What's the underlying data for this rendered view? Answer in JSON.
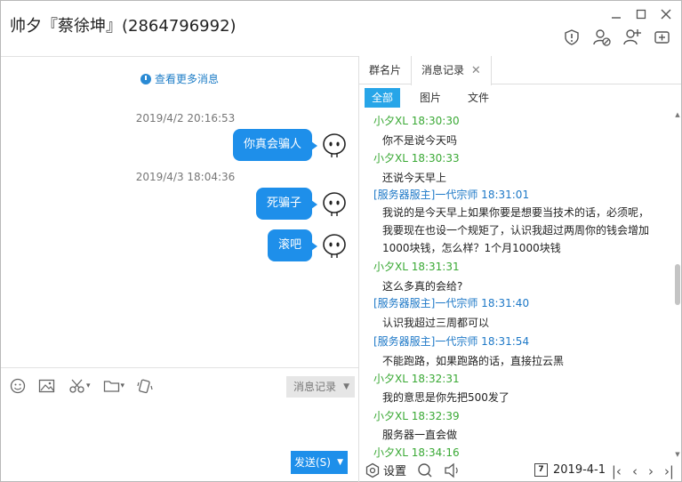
{
  "window": {
    "title": "帅夕『蔡徐坤』(2864796992)",
    "controls": [
      "minimize",
      "maximize",
      "close"
    ]
  },
  "title_tools": [
    "shield-icon",
    "person-block-icon",
    "add-person-icon",
    "add-group-icon"
  ],
  "chat": {
    "more_messages": "查看更多消息",
    "messages": [
      {
        "timestamp": "2019/4/2 20:16:53",
        "text": "你真会骗人"
      },
      {
        "timestamp": "2019/4/3 18:04:36",
        "text": "死骗子"
      },
      {
        "timestamp": "",
        "text": "滚吧"
      }
    ]
  },
  "input": {
    "tools": [
      "emoji-icon",
      "image-icon",
      "scissors-icon",
      "folder-icon",
      "shake-icon"
    ],
    "history_button": "消息记录",
    "send_button": "发送(S)"
  },
  "panel": {
    "tabs": [
      {
        "label": "群名片"
      },
      {
        "label": "消息记录"
      }
    ],
    "filters": [
      "全部",
      "图片",
      "文件"
    ],
    "log": [
      {
        "name": "小夕XL 18:30:30",
        "text": "你不是说今天吗"
      },
      {
        "name": "小夕XL 18:30:33",
        "text": "还说今天早上"
      },
      {
        "name": "[服务器服主]一代宗师 18:31:01",
        "text": "我说的是今天早上如果你要是想要当技术的话，必须呢，我要现在也设一个规矩了，认识我超过两周你的钱会增加1000块钱，怎么样？1个月1000块钱"
      },
      {
        "name": "小夕XL 18:31:31",
        "text": "这么多真的会给?"
      },
      {
        "name": "[服务器服主]一代宗师 18:31:40",
        "text": "认识我超过三周都可以"
      },
      {
        "name": "[服务器服主]一代宗师 18:31:54",
        "text": "不能跑路，如果跑路的话，直接拉云黑"
      },
      {
        "name": "小夕XL 18:32:31",
        "text": "我的意思是你先把500发了"
      },
      {
        "name": "小夕XL 18:32:39",
        "text": "服务器一直会做"
      },
      {
        "name": "小夕XL 18:34:16",
        "text": ""
      }
    ],
    "bottom": {
      "settings_label": "设置",
      "date_icon_digit": "7",
      "date": "2019-4-1"
    }
  },
  "colors": {
    "accent": "#1e8fea",
    "filter_active": "#27a5e8",
    "name_self": "#3aa935",
    "name_admin": "#1d78c7"
  }
}
